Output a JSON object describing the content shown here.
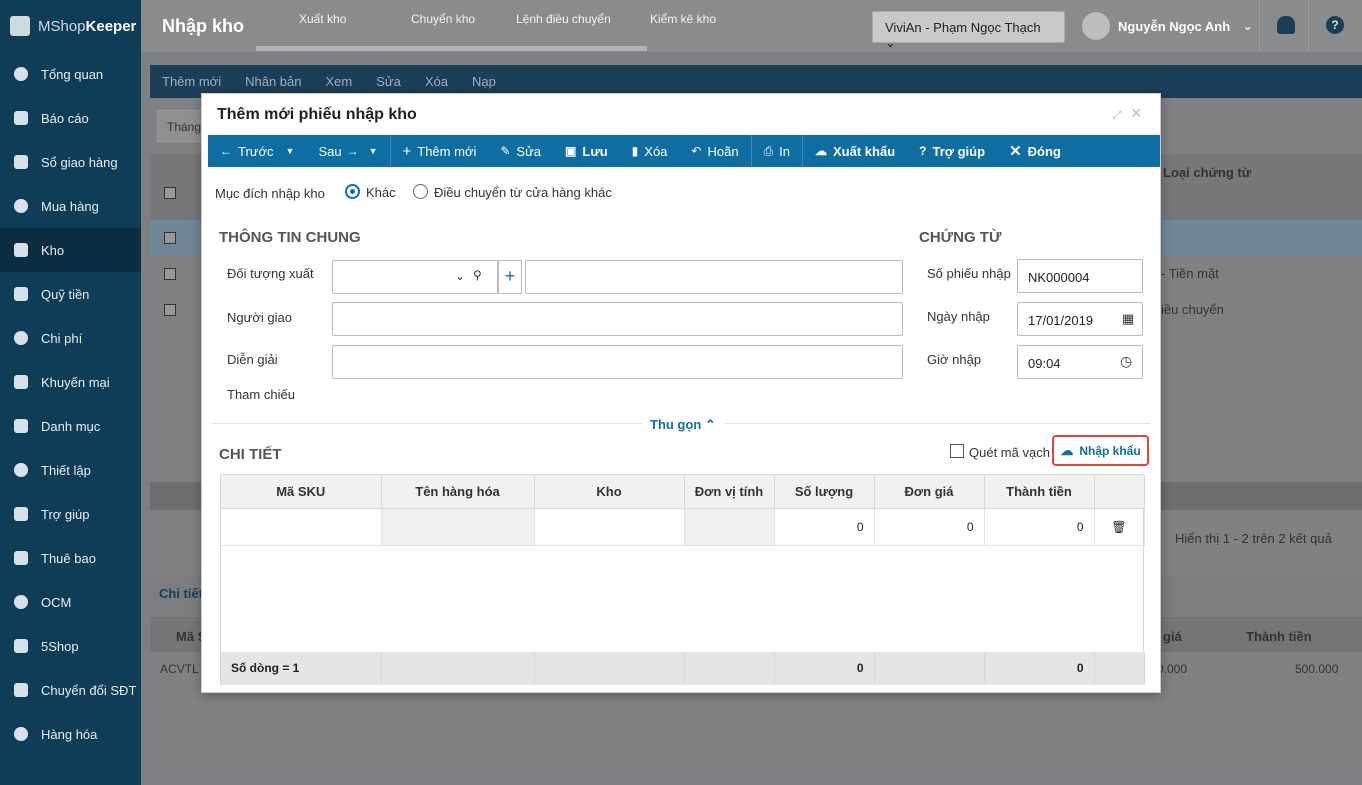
{
  "app": {
    "logo_prefix": "MShop",
    "logo_suffix": "Keeper"
  },
  "sidebar": {
    "items": [
      {
        "label": "Tổng quan",
        "icon": "dashboard-icon"
      },
      {
        "label": "Báo cáo",
        "icon": "pie-chart-icon"
      },
      {
        "label": "Sổ giao hàng",
        "icon": "delivery-book-icon"
      },
      {
        "label": "Mua hàng",
        "icon": "cart-icon"
      },
      {
        "label": "Kho",
        "icon": "warehouse-icon"
      },
      {
        "label": "Quỹ tiền",
        "icon": "cash-fund-icon"
      },
      {
        "label": "Chi phí",
        "icon": "expense-icon"
      },
      {
        "label": "Khuyến mại",
        "icon": "gift-icon"
      },
      {
        "label": "Danh mục",
        "icon": "list-icon"
      },
      {
        "label": "Thiết lập",
        "icon": "gear-icon"
      },
      {
        "label": "Trợ giúp",
        "icon": "help-icon"
      },
      {
        "label": "Thuê bao",
        "icon": "user-icon"
      },
      {
        "label": "OCM",
        "icon": "ocm-icon"
      },
      {
        "label": "5Shop",
        "icon": "5shop-icon"
      },
      {
        "label": "Chuyển đổi SĐT",
        "icon": "phone-convert-icon"
      },
      {
        "label": "Hàng hóa",
        "icon": "goods-icon"
      }
    ]
  },
  "header": {
    "title": "Nhập kho",
    "tabs": [
      "Xuất kho",
      "Chuyển kho",
      "Lệnh điều chuyển",
      "Kiểm kê kho"
    ],
    "store": "ViviAn - Phạm Ngọc Thạch",
    "user": "Nguyễn Ngọc Anh"
  },
  "background": {
    "toolbar": [
      "Thêm mới",
      "Nhân bản",
      "Xem",
      "Sửa",
      "Xóa",
      "Nạp"
    ],
    "filter_field": "Tháng",
    "col_header": "Loại chứng từ",
    "row1_type": "- Tiền mặt",
    "row2_type": "iều chuyển",
    "pagination": "Hiển thị 1 - 2 trên 2 kết quả",
    "detail_tab": "Chi tiết",
    "detail_col_sku": "Mã S",
    "detail_col_price": "giá",
    "detail_col_total": "Thành tiền",
    "detail_row_sku": "ACVTL",
    "detail_row_price": "0.000",
    "detail_row_total": "500.000"
  },
  "modal": {
    "title": "Thêm mới phiếu nhập kho",
    "toolbar": {
      "prev": "Trước",
      "next": "Sau",
      "add": "Thêm mới",
      "edit": "Sửa",
      "save": "Lưu",
      "delete": "Xóa",
      "undo": "Hoãn",
      "print": "In",
      "export": "Xuất khẩu",
      "help": "Trợ giúp",
      "close": "Đóng"
    },
    "purpose_label": "Mục đích nhập kho",
    "purpose_options": [
      "Khác",
      "Điều chuyển từ cửa hàng khác"
    ],
    "general_section": "THÔNG TIN CHUNG",
    "doc_section": "CHỨNG TỪ",
    "fields": {
      "doi_tuong_xuat": "Đối tượng xuất",
      "nguoi_giao": "Người giao",
      "dien_giai": "Diễn giải",
      "tham_chieu": "Tham chiếu",
      "so_phieu_label": "Số phiếu nhập",
      "so_phieu": "NK000004",
      "ngay_nhap_label": "Ngày nhập",
      "ngay_nhap": "17/01/2019",
      "gio_nhap_label": "Giờ nhập",
      "gio_nhap": "09:04"
    },
    "collapse": "Thu gọn",
    "detail_section": "CHI TIẾT",
    "scan_barcode": "Quét mã vạch",
    "import": "Nhập khẩu",
    "grid": {
      "columns": [
        "Mã SKU",
        "Tên hàng hóa",
        "Kho",
        "Đơn vị tính",
        "Số lượng",
        "Đơn giá",
        "Thành tiền",
        ""
      ],
      "row": {
        "qty": "0",
        "price": "0",
        "total": "0"
      },
      "footer": {
        "count": "Số dòng = 1",
        "qty": "0",
        "total": "0"
      }
    }
  }
}
